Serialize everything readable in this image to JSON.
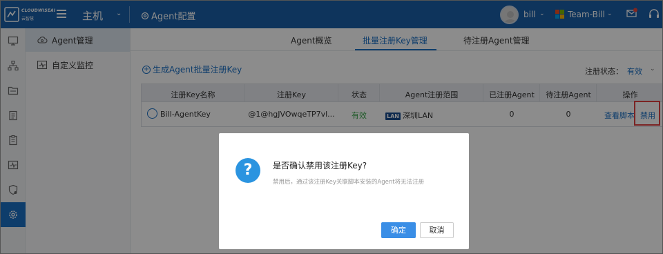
{
  "topbar": {
    "logo_name": "CLOUDWISEAI",
    "logo_sub": "云智慧",
    "host_label": "主机",
    "agent_config_label": "Agent配置",
    "user_name": "bill",
    "team_name": "Team-Bill",
    "colors": {
      "background": "#1a5fa8"
    }
  },
  "rail": {
    "items": [
      "monitor-icon",
      "topology-icon",
      "folder-icon",
      "clipboard-icon",
      "report-icon",
      "chart-icon",
      "shield-icon",
      "gear-icon"
    ],
    "active_index": 7
  },
  "submenu": {
    "items": [
      {
        "label": "Agent管理",
        "active": true
      },
      {
        "label": "自定义监控",
        "active": false
      }
    ]
  },
  "tabs": [
    {
      "label": "Agent概览",
      "active": false
    },
    {
      "label": "批量注册Key管理",
      "active": true
    },
    {
      "label": "待注册Agent管理",
      "active": false
    }
  ],
  "toolbar": {
    "generate_label": "生成Agent批量注册Key",
    "status_filter_label": "注册状态：",
    "status_filter_value": "有效"
  },
  "table": {
    "headers": [
      "注册Key名称",
      "注册Key",
      "状态",
      "Agent注册范围",
      "已注册Agent",
      "待注册Agent",
      "操作"
    ],
    "rows": [
      {
        "name": "Bill-AgentKey",
        "key": "@1@hgJVOwqeTP7vl...",
        "status": "有效",
        "scope_badge": "LAN",
        "scope": "深圳LAN",
        "registered": "0",
        "pending": "0",
        "action_view": "查看脚本",
        "action_disable": "禁用"
      }
    ]
  },
  "modal": {
    "icon": "question-icon",
    "title": "是否确认禁用该注册Key?",
    "description": "禁用后，通过该注册Key关联脚本安装的Agent将无法注册",
    "confirm_label": "确定",
    "cancel_label": "取消"
  }
}
